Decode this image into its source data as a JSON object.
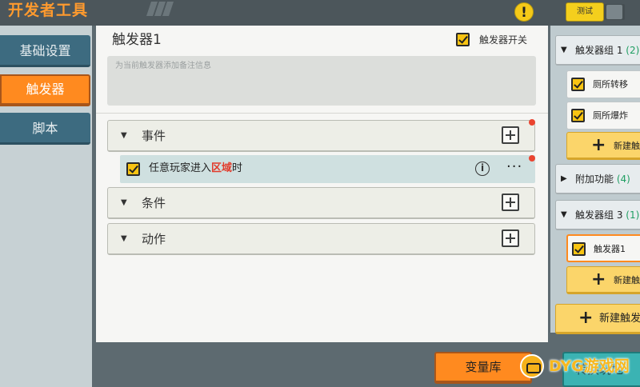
{
  "header": {
    "title": "开发者工具",
    "alert_glyph": "!",
    "test_label": "测试"
  },
  "sidebar": {
    "items": [
      {
        "label": "基础设置",
        "active": false
      },
      {
        "label": "触发器",
        "active": true
      },
      {
        "label": "脚本",
        "active": false
      }
    ]
  },
  "main": {
    "trigger_title": "触发器1",
    "switch_label": "触发器开关",
    "switch_checked": true,
    "note_placeholder": "为当前触发器添加备注信息",
    "sections": [
      {
        "label": "事件",
        "has_dot": true
      },
      {
        "label": "条件",
        "has_dot": false
      },
      {
        "label": "动作",
        "has_dot": false
      }
    ],
    "event_row": {
      "text_before": "任意玩家进入",
      "text_highlight": "区域",
      "text_after": "时",
      "checked": true,
      "info_glyph": "i",
      "more_glyph": "···"
    }
  },
  "right_panel": {
    "group1": {
      "name": "触发器组 1",
      "count": "(2)"
    },
    "group1_items": [
      {
        "label": "厕所转移",
        "checked": true
      },
      {
        "label": "厕所爆炸",
        "checked": true
      }
    ],
    "new_trigger_short": "新建触",
    "extra_group": {
      "name": "附加功能",
      "count": "(4)"
    },
    "group3": {
      "name": "触发器组 3",
      "count": "(1)"
    },
    "group3_items": [
      {
        "label": "触发器1",
        "checked": true,
        "selected": true
      }
    ],
    "new_trigger_long": "新建触发",
    "plus_glyph": "+"
  },
  "bottom": {
    "variables_label": "变量库",
    "teal_label": "转换玩地"
  },
  "watermark": {
    "text": "DYG游戏网"
  },
  "colors": {
    "accent_orange": "#ff8a1f",
    "highlight_red": "#e23a2a",
    "count_green": "#1f9e62",
    "checkbox_yellow": "#f8c412"
  }
}
